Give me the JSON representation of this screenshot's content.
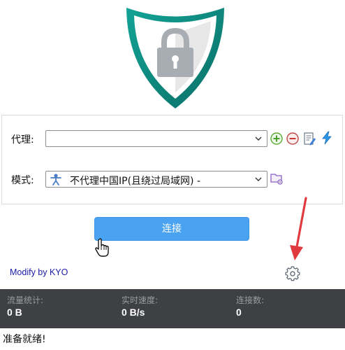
{
  "form": {
    "proxy_label": "代理:",
    "proxy_value": "",
    "mode_label": "模式:",
    "mode_value": "不代理中国IP(且绕过局域网) -"
  },
  "icons": {
    "logo": "shield-lock-icon",
    "add": "plus-circle-icon",
    "remove": "minus-circle-icon",
    "edit": "edit-document-icon",
    "quick": "lightning-icon",
    "mode_edit": "folder-edit-icon",
    "settings": "gear-icon",
    "cursor": "hand-pointer-icon",
    "mode": "person-icon"
  },
  "connect_label": "连接",
  "modify_link": "Modify by KYO",
  "stats": {
    "traffic_label": "流量统计:",
    "traffic_value": "0 B",
    "speed_label": "实时速度:",
    "speed_value": "0 B/s",
    "connections_label": "连接数:",
    "connections_value": "0"
  },
  "status": "准备就绪!",
  "colors": {
    "accent": "#4aa3f0",
    "stats_bg": "#3e4043",
    "shield_outer": "#0e8a80",
    "link": "#1a1aa6",
    "arrow": "#e0393e"
  }
}
